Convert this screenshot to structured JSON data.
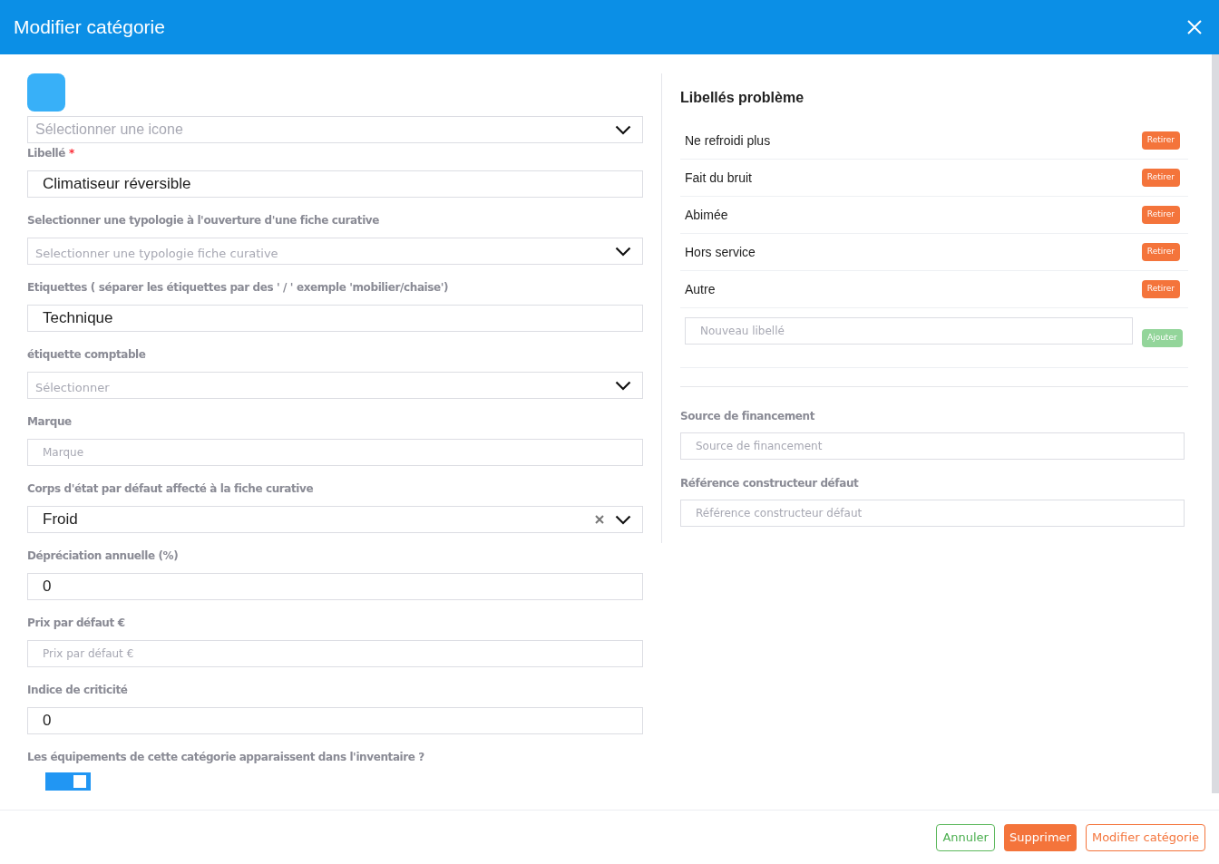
{
  "dialog": {
    "title": "Modifier catégorie"
  },
  "fields": [
    {
      "kind": "icon_select",
      "placeholder": "Sélectionner une icone"
    },
    {
      "kind": "input",
      "label": "Libellé",
      "required_mark": "*",
      "value": "Climatiseur réversible"
    },
    {
      "kind": "select",
      "label": "Selectionner une typologie à l'ouverture d'une fiche curative",
      "placeholder": "Selectionner une typologie fiche curative"
    },
    {
      "kind": "input",
      "label": "Etiquettes ( séparer les étiquettes par des ' / ' exemple 'mobilier/chaise')",
      "value": "Technique"
    },
    {
      "kind": "select",
      "label": "étiquette comptable",
      "placeholder": "Sélectionner"
    },
    {
      "kind": "input",
      "label": "Marque",
      "placeholder": "Marque"
    },
    {
      "kind": "select",
      "label": "Corps d'état par défaut affecté à la fiche curative",
      "value": "Froid",
      "clearable": true
    },
    {
      "kind": "input",
      "label": "Dépréciation annuelle (%)",
      "value": "0"
    },
    {
      "kind": "input",
      "label": "Prix par défaut €",
      "placeholder": "Prix par défaut €"
    },
    {
      "kind": "input",
      "label": "Indice de criticité",
      "value": "0"
    },
    {
      "kind": "toggle",
      "label": "Les équipements de cette catégorie apparaissent dans l'inventaire ?",
      "on": true
    }
  ],
  "problems": {
    "title": "Libellés problème",
    "items": [
      {
        "label": "Ne refroidi plus",
        "button": "Retirer"
      },
      {
        "label": "Fait du bruit",
        "button": "Retirer"
      },
      {
        "label": "Abimée",
        "button": "Retirer"
      },
      {
        "label": "Hors service",
        "button": "Retirer"
      },
      {
        "label": "Autre",
        "button": "Retirer"
      }
    ],
    "new_placeholder": "Nouveau libellé",
    "add_button": "Ajouter",
    "add_disabled": true
  },
  "right_fields": [
    {
      "label": "Source de financement",
      "placeholder": "Source de financement"
    },
    {
      "label": "Référence constructeur défaut",
      "placeholder": "Référence constructeur défaut"
    }
  ],
  "footer": {
    "cancel": "Annuler",
    "delete": "Supprimer",
    "submit": "Modifier catégorie"
  }
}
